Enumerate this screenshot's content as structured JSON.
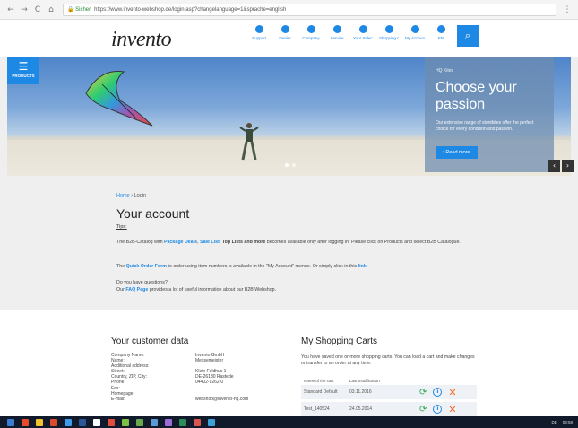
{
  "browser": {
    "back": "←",
    "forward": "→",
    "reload": "C",
    "home": "⌂",
    "secure_label": "🔒 Sicher",
    "url": "https://www.invento-webshop.de/login.asp?changelanguage=1&sprache=english",
    "menu": "⋮"
  },
  "header": {
    "logo": "invento",
    "nav": [
      {
        "label": "Support",
        "icon": "chat-icon"
      },
      {
        "label": "Dealer",
        "icon": "location-icon"
      },
      {
        "label": "Company",
        "icon": "company-icon"
      },
      {
        "label": "Service",
        "icon": "service-icon"
      },
      {
        "label": "Your Selection",
        "icon": "heart-icon"
      },
      {
        "label": "Shopping Cart",
        "icon": "cart-icon"
      },
      {
        "label": "My Account",
        "icon": "user-icon"
      },
      {
        "label": "EN",
        "icon": "globe-icon"
      }
    ],
    "search_icon": "search-icon"
  },
  "products_tab": {
    "label": "PRODUCTS",
    "icon": "menu-icon"
  },
  "hero": {
    "eyebrow": "HQ Kites",
    "title": "Choose your passion",
    "text": "Our extensive range of stuntkites offer the perfect choice for every condition and passion.",
    "button": "› Read more",
    "prev": "‹",
    "next": "›"
  },
  "account": {
    "breadcrumb_home": "Home",
    "breadcrumb_sep": "›",
    "breadcrumb_current": "Login",
    "title": "Your account",
    "tips": "Tips:",
    "p1_a": "The B2B-Catalog with ",
    "p1_b": "Package Deals",
    "p1_c": ", ",
    "p1_d": "Sale List",
    "p1_e": ", ",
    "p1_f": "Top Lists and more",
    "p1_g": " becomes available only after logging in. Please click on Products and select B2B Catalogue.",
    "p2_a": "The ",
    "p2_b": "Quick Order Form",
    "p2_c": " to order using item numbers is available in the \"My Account\" menue. Or simply click in this ",
    "p2_d": "link",
    "p2_e": ".",
    "p3_a": "Do you have questions?",
    "p3_b": "Our ",
    "p3_c": "FAQ Page",
    "p3_d": " provides a lot of useful information about our B2B Webshop."
  },
  "customer": {
    "title": "Your customer data",
    "rows": [
      {
        "label": "Company Name:",
        "value": "Invento GmbH"
      },
      {
        "label": "Name:",
        "value": "Messemeister"
      },
      {
        "label": "Additional address:",
        "value": ""
      },
      {
        "label": "Street:",
        "value": "Klein Feldhus 1"
      },
      {
        "label": "Country, ZIP, City:",
        "value": "DE-26180 Rastede"
      },
      {
        "label": "Phone:",
        "value": "04402-9262-0"
      },
      {
        "label": "Fax:",
        "value": ""
      },
      {
        "label": "Homepage",
        "value": ""
      },
      {
        "label": "E-mail:",
        "value": "webshop@invento-hq.com"
      }
    ]
  },
  "carts": {
    "title": "My Shopping Carts",
    "intro": "You have saved one or more shopping carts. You can load a cart and make changes or transfer to an order at any time.",
    "head_name": "Name of the cart",
    "head_date": "Last modification",
    "rows": [
      {
        "name": "Standard Default",
        "date": "03.11.2016"
      },
      {
        "name": "Test_140524",
        "date": "24.05.2014"
      }
    ]
  },
  "taskbar": {
    "time": "09:58",
    "lang": "DE",
    "colors": [
      "#3a7bd5",
      "#e84b2a",
      "#f2c12e",
      "#d94b2b",
      "#3c9ae8",
      "#2b5797",
      "#ffffff",
      "#e24c3c",
      "#7cc242",
      "#6aa84f",
      "#5b9bd5",
      "#9e6ad6",
      "#2e8b57",
      "#d9534f",
      "#3aa0d8"
    ]
  }
}
